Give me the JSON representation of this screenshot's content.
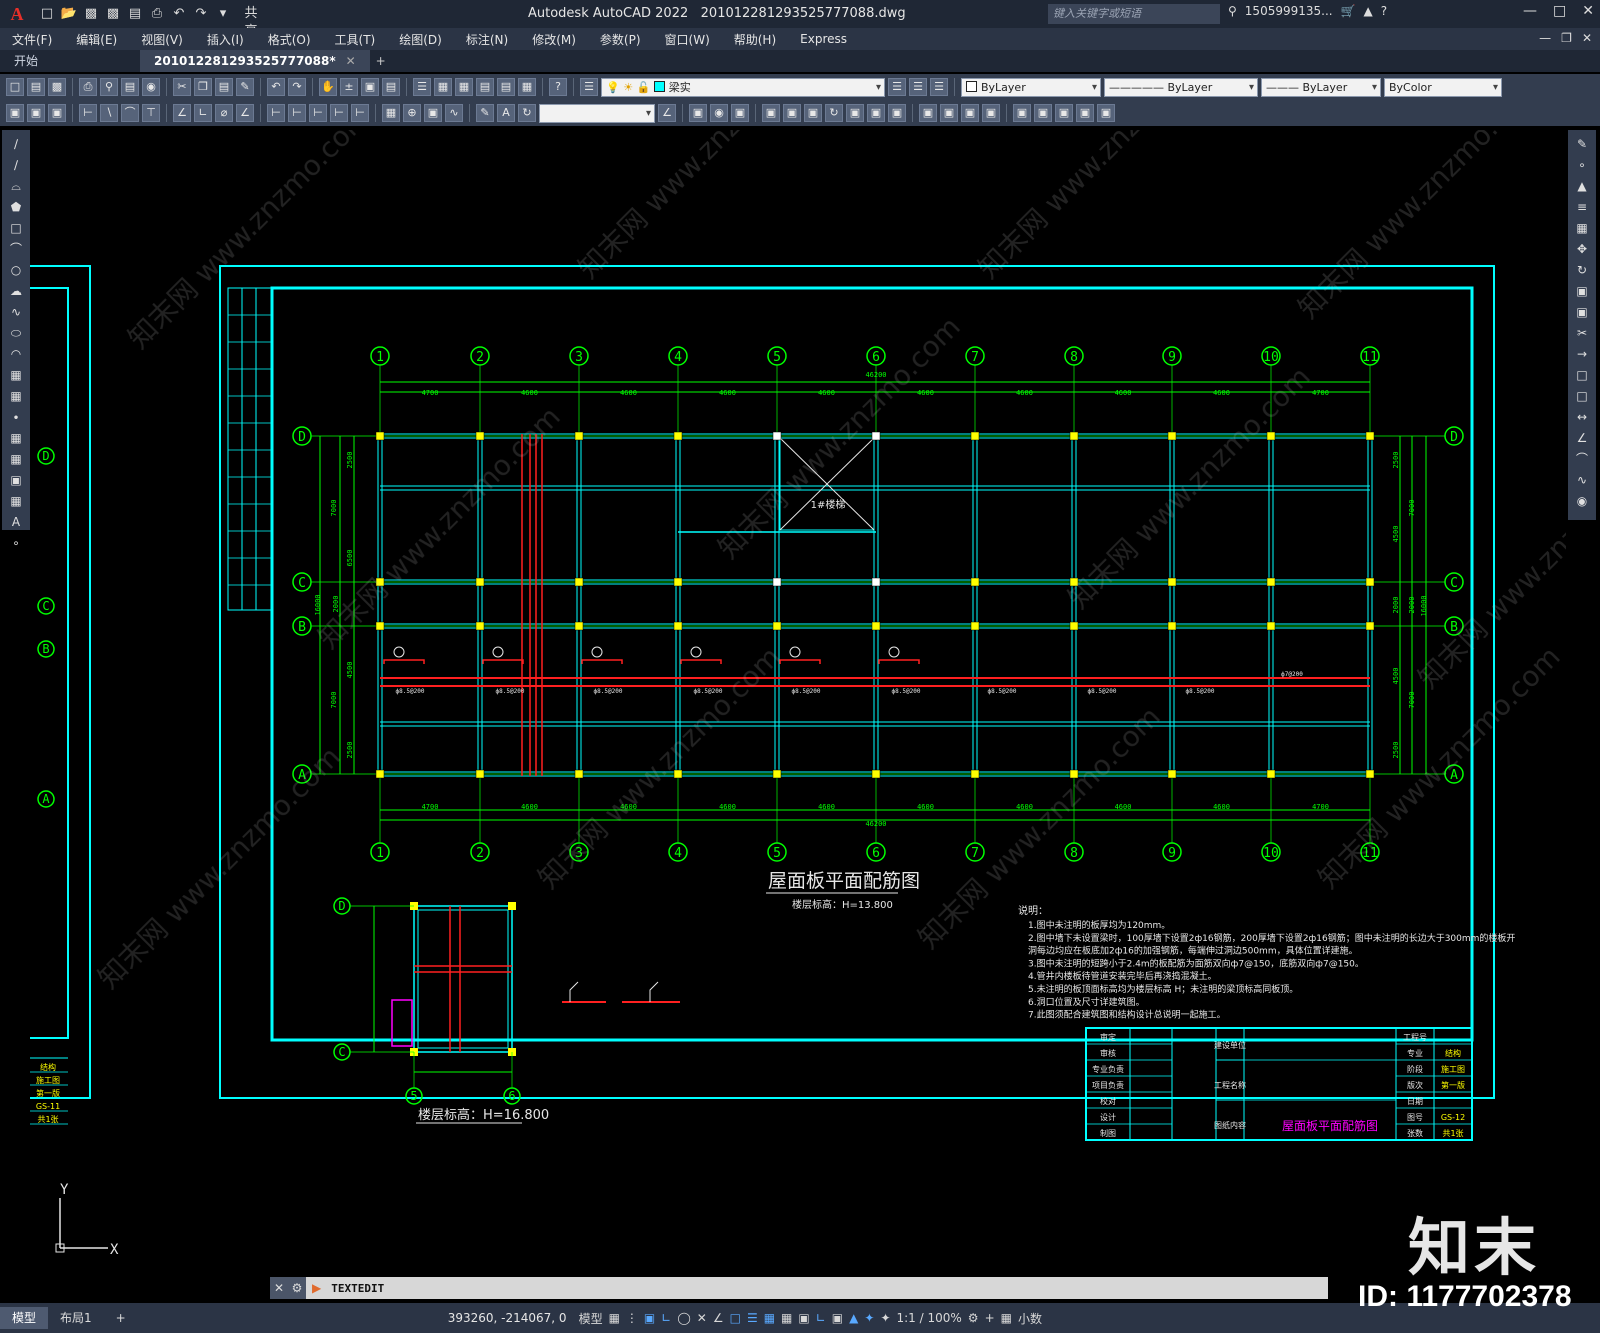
{
  "app": {
    "title": "Autodesk AutoCAD 2022",
    "file_name": "201012281293525777088.dwg",
    "share_label": "共享",
    "search_placeholder": "键入关键字或短语",
    "user": "1505999135...",
    "help_icon": "?"
  },
  "menu": [
    "文件(F)",
    "编辑(E)",
    "视图(V)",
    "插入(I)",
    "格式(O)",
    "工具(T)",
    "绘图(D)",
    "标注(N)",
    "修改(M)",
    "参数(P)",
    "窗口(W)",
    "帮助(H)",
    "Express"
  ],
  "tabs": {
    "start": "开始",
    "active": "201012281293525777088*"
  },
  "properties": {
    "layer": "梁实",
    "color": "ByLayer",
    "linetype": "ByLayer",
    "lineweight": "ByLayer",
    "plotstyle": "ByColor"
  },
  "drawing": {
    "main_title": "屋面板平面配筋图",
    "main_subtitle": "楼层标高：H=13.800",
    "detail_title": "楼层标高：H=16.800",
    "axes_top": [
      "1",
      "2",
      "3",
      "4",
      "5",
      "6",
      "7",
      "8",
      "9",
      "10",
      "11"
    ],
    "axes_side": [
      "D",
      "C",
      "B",
      "A"
    ],
    "top_dims": [
      "4700",
      "4600",
      "4600",
      "4600",
      "4600",
      "4600",
      "4600",
      "4600",
      "4600",
      "4700"
    ],
    "total_dim": "46200",
    "left_dims": [
      "2500",
      "7000",
      "6500",
      "16000",
      "2000",
      "4500",
      "7000",
      "2500"
    ],
    "right_dims": [
      "2500",
      "4500",
      "7000",
      "2000",
      "2000",
      "16000",
      "4500",
      "7000",
      "2500"
    ],
    "stair_label": "1#楼梯",
    "rebar_labels": [
      "ф8.5@200",
      "ф8.5@200",
      "ф8.5@200",
      "ф8.5@200",
      "ф8.5@200",
      "ф8.5@200",
      "ф8.5@200",
      "ф8.5@200",
      "ф8.5@200",
      "ф7@200"
    ],
    "notes_title": "说明：",
    "notes": [
      "1.图中未注明的板厚均为120mm。",
      "2.图中墙下未设置梁时，100厚墙下设置2ф16钢筋，200厚墙下设置2ф16钢筋；图中未注明的长边大于300mm的楼板开",
      "  洞每边均应在板底加2ф16的加强钢筋，每端伸过洞边500mm，具体位置详建施。",
      "3.图中未注明的短跨小于2.4m的板配筋为面筋双向ф7@150，底筋双向ф7@150。",
      "4.管井内楼板待管道安装完毕后再浇捣混凝土。",
      "5.未注明的板顶面标高均为楼层标高 H；未注明的梁顶标高同板顶。",
      "6.洞口位置及尺寸详建筑图。",
      "7.此图须配合建筑图和结构设计总说明一起施工。"
    ],
    "title_block": {
      "rows_left": [
        "审定",
        "审核",
        "专业负责",
        "项目负责",
        "校对",
        "设计",
        "制图"
      ],
      "rows_mid": [
        "建设单位",
        "工程名称",
        "图纸内容"
      ],
      "rows_right_labels": [
        "工程号",
        "专业",
        "阶段",
        "版次",
        "日期",
        "图号",
        "张数"
      ],
      "rows_right_values": [
        "",
        "结构",
        "施工图",
        "第一版",
        "",
        "GS-12",
        "共1张"
      ],
      "drawing_name": "屋面板平面配筋图"
    },
    "left_sheet": {
      "values": [
        "结构",
        "施工图",
        "第一版",
        "GS-11",
        "共1张"
      ],
      "axes": [
        "D",
        "C",
        "B",
        "A"
      ]
    },
    "ucs": {
      "x": "X",
      "y": "Y"
    }
  },
  "command": {
    "text": "TEXTEDIT"
  },
  "status": {
    "tab_model": "模型",
    "tab_layout": "布局1",
    "add_tab": "+",
    "coords": "393260, -214067, 0",
    "model_label": "模型",
    "scale": "1:1 / 100%",
    "units": "小数"
  },
  "watermark": {
    "logo": "知末",
    "id": "ID: 1177702378",
    "site": "知末网 www.znzmo.com"
  },
  "colors": {
    "cyan": "#00ffff",
    "green": "#00ff00",
    "yellow": "#ffff00",
    "red": "#ff2020",
    "magenta": "#ff00ff",
    "toolbar": "#333d4f"
  }
}
